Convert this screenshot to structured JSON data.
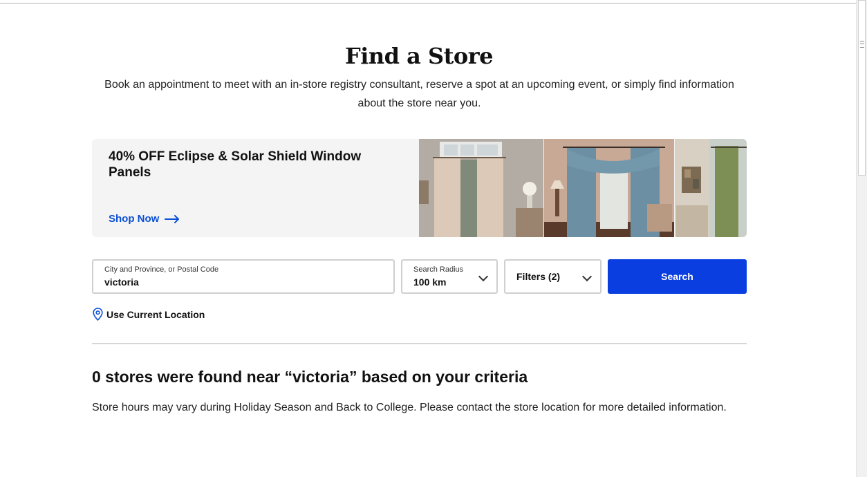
{
  "header": {
    "title": "Find a Store",
    "intro": "Book an appointment to meet with an in-store registry consultant, reserve a spot at an upcoming event, or simply find information about the store near you."
  },
  "promo": {
    "headline": "40% OFF Eclipse & Solar Shield Window Panels",
    "cta": "Shop Now",
    "image_description_icons": [
      "curtain-photo",
      "curtain-photo",
      "curtain-photo"
    ]
  },
  "search": {
    "location_label": "City and Province, or Postal Code",
    "location_value": "victoria",
    "radius_label": "Search Radius",
    "radius_value": "100 km",
    "filters_label": "Filters (2)",
    "search_button": "Search",
    "use_location": "Use Current Location"
  },
  "results": {
    "heading": "0 stores were found near “victoria” based on your criteria",
    "note": "Store hours may vary during Holiday Season and Back to College. Please contact the store location for more detailed information."
  },
  "colors": {
    "accent": "#0a3ee0",
    "link": "#0a4fd6",
    "promo_bg": "#f4f4f4"
  }
}
